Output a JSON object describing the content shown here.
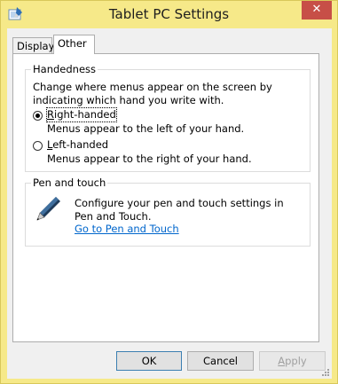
{
  "window": {
    "title": "Tablet PC Settings",
    "close_glyph": "✕",
    "background_color": "#f6e989",
    "close_color": "#c74f47"
  },
  "tabs": [
    {
      "label": "Display",
      "selected": false
    },
    {
      "label": "Other",
      "selected": true
    }
  ],
  "handedness": {
    "group_title": "Handedness",
    "description": "Change where menus appear on the screen by indicating which hand you write with.",
    "options": [
      {
        "label": "Right-handed",
        "hint": "Menus appear to the left of your hand.",
        "checked": true
      },
      {
        "label": "Left-handed",
        "hint": "Menus appear to the right of your hand.",
        "checked": false
      }
    ]
  },
  "pen_touch": {
    "group_title": "Pen and touch",
    "description": "Configure your pen and touch settings in Pen and Touch.",
    "link_text": "Go to Pen and Touch",
    "icon": "pen-icon"
  },
  "buttons": {
    "ok": "OK",
    "cancel": "Cancel",
    "apply": "Apply",
    "apply_enabled": false
  }
}
